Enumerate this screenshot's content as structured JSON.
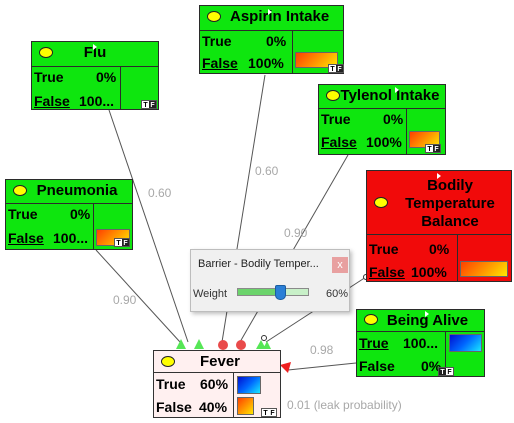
{
  "links": {
    "l1": "0.60",
    "l2": "0.60",
    "l3": "0.90",
    "l4": "0.90",
    "l5": "0.98",
    "leak": "0.01 (leak probability)"
  },
  "nodes": {
    "aspirin": {
      "title": "Aspirin Intake",
      "r1k": "True",
      "r1v": "0%",
      "r2k": "False",
      "r2v": "100%",
      "tf": [
        "T",
        "F"
      ]
    },
    "flu": {
      "title": "Flu",
      "r1k": "True",
      "r1v": "0%",
      "r2k": "False",
      "r2v": "100...",
      "tf": [
        "T",
        "F"
      ]
    },
    "tylenol": {
      "title": "Tylenol Intake",
      "r1k": "True",
      "r1v": "0%",
      "r2k": "False",
      "r2v": "100%",
      "tf": [
        "T",
        "F"
      ]
    },
    "pneumonia": {
      "title": "Pneumonia",
      "r1k": "True",
      "r1v": "0%",
      "r2k": "False",
      "r2v": "100...",
      "tf": [
        "T",
        "F"
      ]
    },
    "bodily": {
      "title": "Bodily Temperature Balance",
      "r1k": "True",
      "r1v": "0%",
      "r2k": "False",
      "r2v": "100%"
    },
    "alive": {
      "title": "Being Alive",
      "r1k": "True",
      "r1v": "100...",
      "r2k": "False",
      "r2v": "0%",
      "tf": [
        "T",
        "F"
      ]
    },
    "fever": {
      "title": "Fever",
      "r1k": "True",
      "r1v": "60%",
      "r2k": "False",
      "r2v": "40%",
      "tf": [
        "T",
        "F"
      ]
    }
  },
  "popup": {
    "title": "Barrier - Bodily Temper...",
    "close": "x",
    "weight_label": "Weight",
    "weight_value": "60%",
    "weight_fraction": 0.6
  },
  "colors": {
    "node_green": "#0ee60e",
    "node_red": "#f10a0a",
    "fever_bg": "#fff0f0"
  }
}
